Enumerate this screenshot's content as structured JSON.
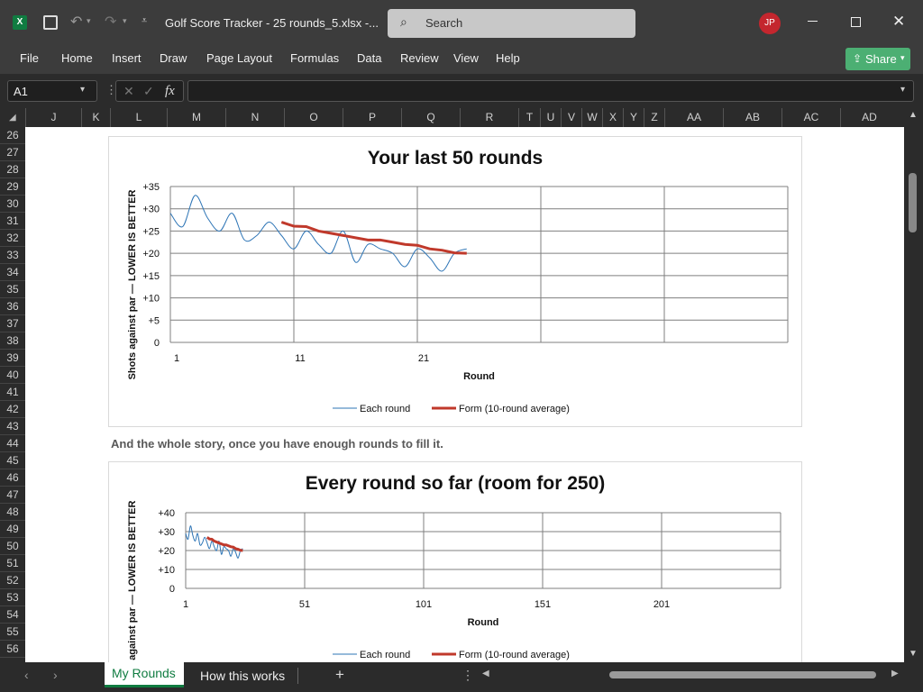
{
  "window": {
    "title": "Golf Score Tracker - 25 rounds_5.xlsx  -...",
    "search_placeholder": "Search",
    "avatar": "JP",
    "share_label": "Share"
  },
  "menu": [
    "File",
    "Home",
    "Insert",
    "Draw",
    "Page Layout",
    "Formulas",
    "Data",
    "Review",
    "View",
    "Help"
  ],
  "formula_bar": {
    "name_box": "A1",
    "fx": "fx",
    "content": ""
  },
  "columns": [
    "J",
    "K",
    "L",
    "M",
    "N",
    "O",
    "P",
    "Q",
    "R",
    "T",
    "U",
    "V",
    "W",
    "X",
    "Y",
    "Z",
    "AA",
    "AB",
    "AC",
    "AD"
  ],
  "rows": [
    "26",
    "27",
    "28",
    "29",
    "30",
    "31",
    "32",
    "33",
    "34",
    "35",
    "36",
    "37",
    "38",
    "39",
    "40",
    "41",
    "42",
    "43",
    "44",
    "45",
    "46",
    "47",
    "48",
    "49",
    "50",
    "51",
    "52",
    "53",
    "54",
    "55",
    "56"
  ],
  "note_text": "And the whole story, once you have enough rounds to fill it.",
  "sheet_tabs": [
    "My Rounds",
    "How this works"
  ],
  "active_tab": "My Rounds",
  "colors": {
    "each_round": "#2e75b6",
    "form": "#c0392b",
    "accent": "#107c41"
  },
  "chart_data": [
    {
      "type": "line",
      "title": "Your last 50 rounds",
      "xlabel": "Round",
      "ylabel": "Shots against par — LOWER IS BETTER",
      "x_tick_labels": [
        "1",
        "11",
        "21"
      ],
      "y_tick_labels": [
        "0",
        "+5",
        "+10",
        "+15",
        "+20",
        "+25",
        "+30",
        "+35"
      ],
      "xlim": [
        1,
        51
      ],
      "ylim": [
        0,
        35
      ],
      "grid": true,
      "legend_position": "bottom",
      "series": [
        {
          "name": "Each round",
          "x": [
            1,
            2,
            3,
            4,
            5,
            6,
            7,
            8,
            9,
            10,
            11,
            12,
            13,
            14,
            15,
            16,
            17,
            18,
            19,
            20,
            21,
            22,
            23,
            24,
            25
          ],
          "values": [
            29,
            26,
            33,
            28,
            25,
            29,
            23,
            24,
            27,
            24,
            21,
            25,
            22,
            20,
            25,
            18,
            22,
            21,
            20,
            17,
            21,
            19,
            16,
            20,
            21
          ]
        },
        {
          "name": "Form (10-round average)",
          "x": [
            10,
            11,
            12,
            13,
            14,
            15,
            16,
            17,
            18,
            19,
            20,
            21,
            22,
            23,
            24,
            25
          ],
          "values": [
            27,
            26.1,
            26,
            25,
            24.5,
            24,
            23.5,
            23,
            23,
            22.5,
            22,
            21.8,
            21,
            20.7,
            20.1,
            20
          ]
        }
      ]
    },
    {
      "type": "line",
      "title": "Every round so far (room for 250)",
      "xlabel": "Round",
      "ylabel": "Shots against par — LOWER IS BETTER",
      "x_tick_labels": [
        "1",
        "51",
        "101",
        "151",
        "201"
      ],
      "y_tick_labels": [
        "0",
        "+10",
        "+20",
        "+30",
        "+40"
      ],
      "xlim": [
        1,
        251
      ],
      "ylim": [
        0,
        40
      ],
      "grid": true,
      "legend_position": "bottom",
      "series": [
        {
          "name": "Each round",
          "x": [
            1,
            2,
            3,
            4,
            5,
            6,
            7,
            8,
            9,
            10,
            11,
            12,
            13,
            14,
            15,
            16,
            17,
            18,
            19,
            20,
            21,
            22,
            23,
            24,
            25
          ],
          "values": [
            29,
            26,
            33,
            28,
            25,
            29,
            23,
            24,
            27,
            24,
            21,
            25,
            22,
            20,
            25,
            18,
            22,
            21,
            20,
            17,
            21,
            19,
            16,
            20,
            21
          ]
        },
        {
          "name": "Form (10-round average)",
          "x": [
            10,
            11,
            12,
            13,
            14,
            15,
            16,
            17,
            18,
            19,
            20,
            21,
            22,
            23,
            24,
            25
          ],
          "values": [
            27,
            26.1,
            26,
            25,
            24.5,
            24,
            23.5,
            23,
            23,
            22.5,
            22,
            21.8,
            21,
            20.7,
            20.1,
            20
          ]
        }
      ]
    }
  ]
}
